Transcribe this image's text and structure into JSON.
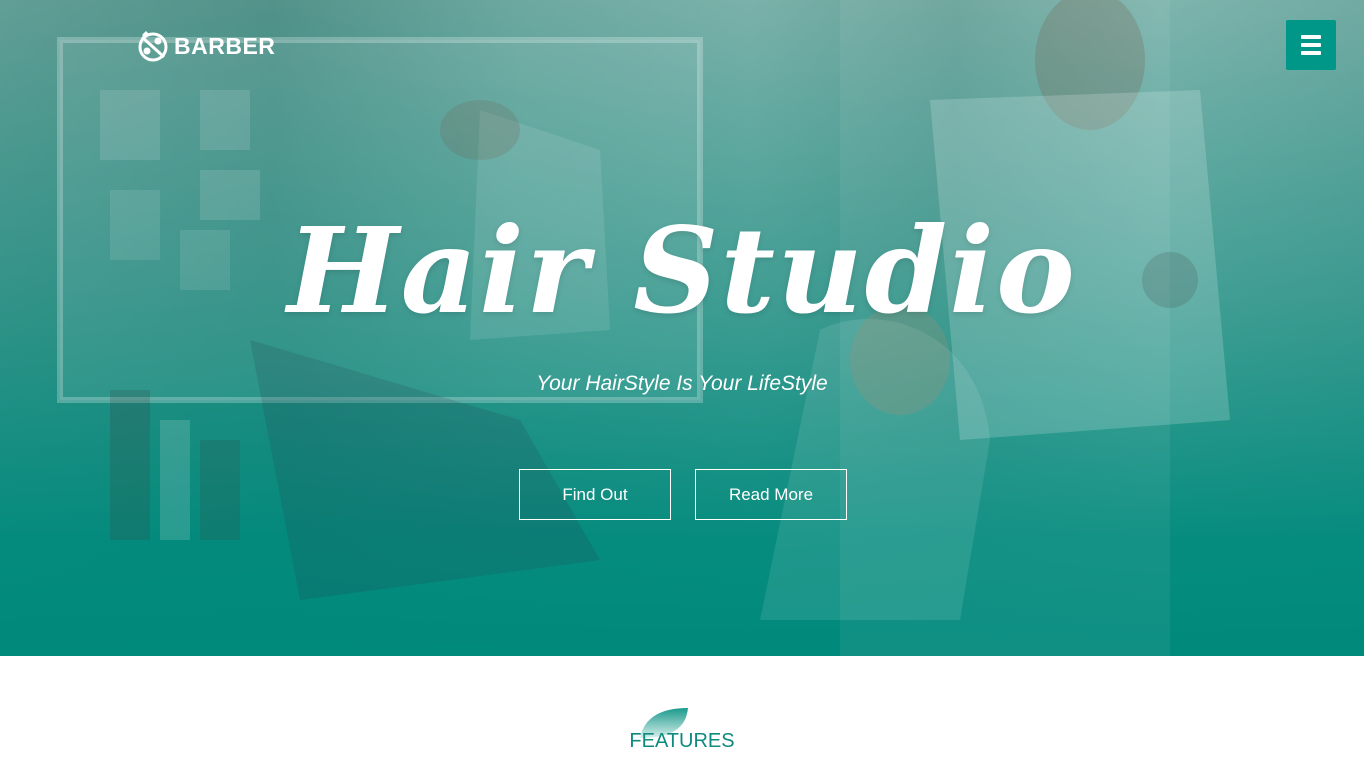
{
  "brand": {
    "name": "BARBER",
    "icon": "scissors-comb-icon"
  },
  "nav": {
    "menu_icon": "hamburger-icon"
  },
  "hero": {
    "title": "Hair Studio",
    "tagline": "Your HairStyle Is Your LifeStyle",
    "buttons": {
      "find_out": "Find Out",
      "read_more": "Read More"
    }
  },
  "features": {
    "title": "FEATURES",
    "icon": "leaf-icon"
  },
  "colors": {
    "accent": "#009688",
    "overlay": "#008a7c",
    "text_on_dark": "#ffffff",
    "features_title": "#0f8a7e"
  }
}
